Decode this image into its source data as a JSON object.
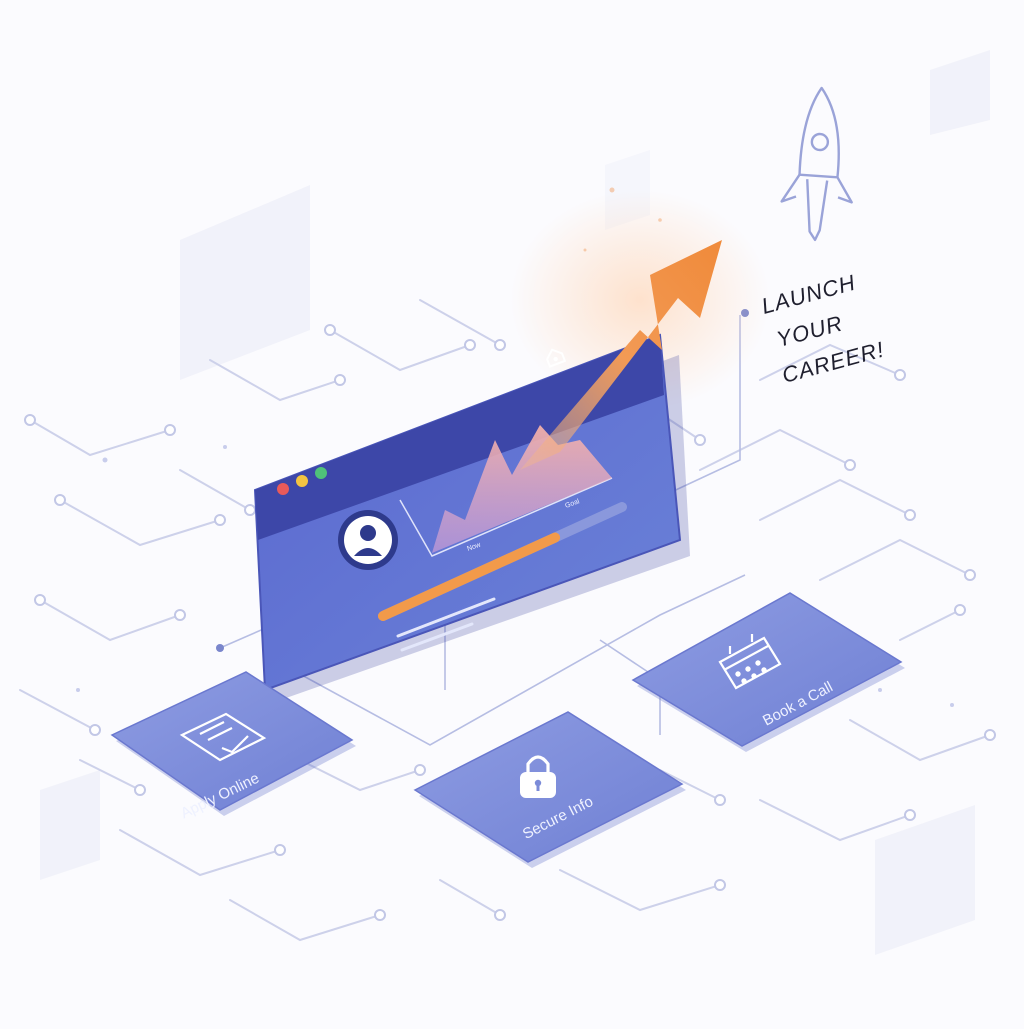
{
  "headline": {
    "line1": "LAUNCH",
    "line2": "YOUR",
    "line3": "CAREER!"
  },
  "dashboard": {
    "chart_label_left": "Now",
    "chart_label_right": "Goal",
    "progress": 0.72
  },
  "actions": {
    "apply": "Apply Online",
    "secure": "Secure Info",
    "book": "Book a Call"
  },
  "colors": {
    "accent": "#f28c3c",
    "panel_top": "#3f4aa8",
    "panel_body": "#5b6dd0",
    "tile": "#7f8fdc",
    "circuit": "#c9cde8"
  },
  "icons": {
    "apply": "document-check-icon",
    "secure": "padlock-icon",
    "book": "calendar-icon",
    "rocket": "rocket-icon",
    "home": "home-icon",
    "avatar": "user-icon"
  }
}
